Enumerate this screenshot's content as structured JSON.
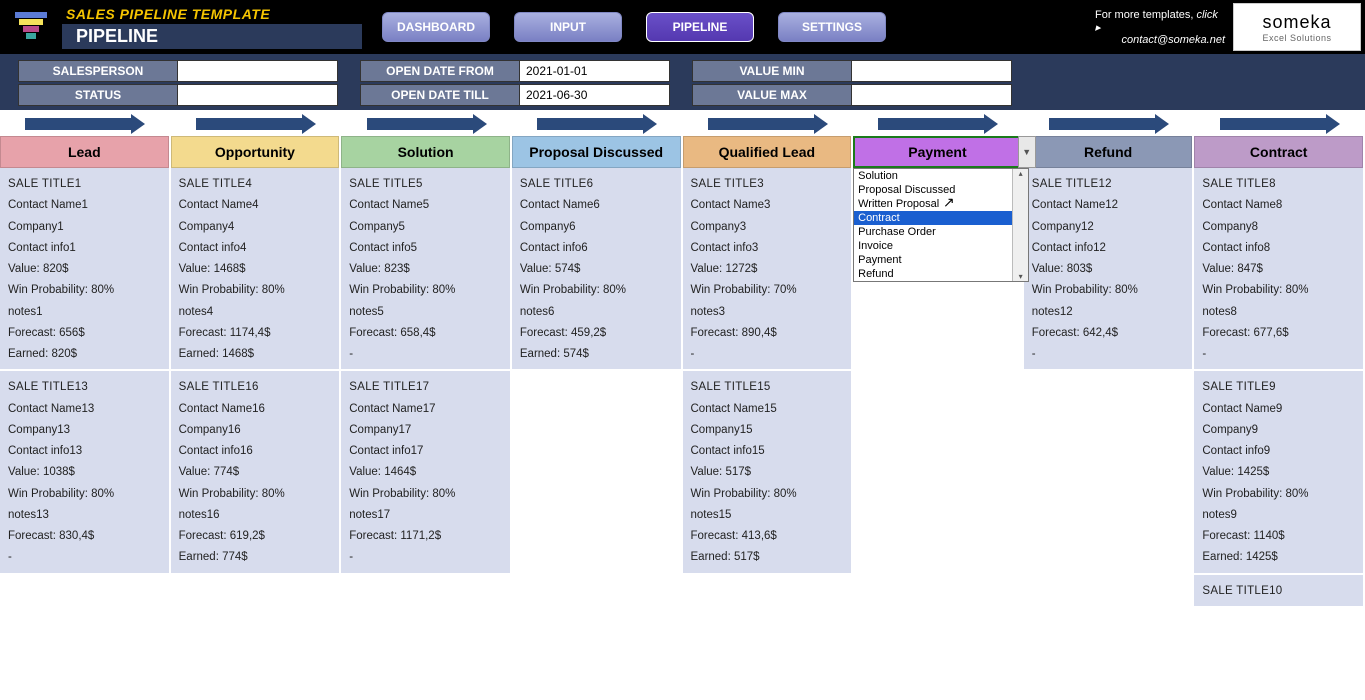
{
  "header": {
    "top_title": "SALES PIPELINE TEMPLATE",
    "page": "PIPELINE",
    "nav": [
      {
        "label": "DASHBOARD",
        "active": false
      },
      {
        "label": "INPUT",
        "active": false
      },
      {
        "label": "PIPELINE",
        "active": true
      },
      {
        "label": "SETTINGS",
        "active": false
      }
    ],
    "more_templates": "For more templates, ",
    "more_templates_link": "click ▸",
    "contact": "contact@someka.net",
    "brand_line1": "someka",
    "brand_line2": "Excel Solutions"
  },
  "filters": {
    "salesperson": {
      "label": "SALESPERSON",
      "value": ""
    },
    "status": {
      "label": "STATUS",
      "value": ""
    },
    "open_from": {
      "label": "OPEN DATE FROM",
      "value": "2021-01-01"
    },
    "open_till": {
      "label": "OPEN DATE TILL",
      "value": "2021-06-30"
    },
    "value_min": {
      "label": "VALUE MIN",
      "value": ""
    },
    "value_max": {
      "label": "VALUE MAX",
      "value": ""
    }
  },
  "stages": [
    {
      "label": "Lead",
      "color": "#e7a2aa"
    },
    {
      "label": "Opportunity",
      "color": "#f3da8e"
    },
    {
      "label": "Solution",
      "color": "#a7d3a1"
    },
    {
      "label": "Proposal Discussed",
      "color": "#9cc4e4"
    },
    {
      "label": "Qualified Lead",
      "color": "#e9b982"
    },
    {
      "label": "Payment",
      "color": "#c070e6"
    },
    {
      "label": "Refund",
      "color": "#8b98b5"
    },
    {
      "label": "Contract",
      "color": "#bd9bc8"
    }
  ],
  "dropdown": {
    "items": [
      "Solution",
      "Proposal Discussed",
      "Written Proposal",
      "Contract",
      "Purchase Order",
      "Invoice",
      "Payment",
      "Refund"
    ],
    "selected": "Contract"
  },
  "columns": [
    [
      {
        "title": "SALE TITLE1",
        "contact": "Contact Name1",
        "company": "Company1",
        "info": "Contact info1",
        "value": "Value: 820$",
        "prob": "Win Probability: 80%",
        "notes": "notes1",
        "forecast": "Forecast: 656$",
        "earned": "Earned: 820$"
      },
      {
        "title": "SALE TITLE13",
        "contact": "Contact Name13",
        "company": "Company13",
        "info": "Contact info13",
        "value": "Value: 1038$",
        "prob": "Win Probability: 80%",
        "notes": "notes13",
        "forecast": "Forecast: 830,4$",
        "earned": "-"
      }
    ],
    [
      {
        "title": "SALE TITLE4",
        "contact": "Contact Name4",
        "company": "Company4",
        "info": "Contact info4",
        "value": "Value: 1468$",
        "prob": "Win Probability: 80%",
        "notes": "notes4",
        "forecast": "Forecast: 1174,4$",
        "earned": "Earned: 1468$"
      },
      {
        "title": "SALE TITLE16",
        "contact": "Contact Name16",
        "company": "Company16",
        "info": "Contact info16",
        "value": "Value: 774$",
        "prob": "Win Probability: 80%",
        "notes": "notes16",
        "forecast": "Forecast: 619,2$",
        "earned": "Earned: 774$"
      }
    ],
    [
      {
        "title": "SALE TITLE5",
        "contact": "Contact Name5",
        "company": "Company5",
        "info": "Contact info5",
        "value": "Value: 823$",
        "prob": "Win Probability: 80%",
        "notes": "notes5",
        "forecast": "Forecast: 658,4$",
        "earned": "-"
      },
      {
        "title": "SALE TITLE17",
        "contact": "Contact Name17",
        "company": "Company17",
        "info": "Contact info17",
        "value": "Value: 1464$",
        "prob": "Win Probability: 80%",
        "notes": "notes17",
        "forecast": "Forecast: 1171,2$",
        "earned": "-"
      }
    ],
    [
      {
        "title": "SALE TITLE6",
        "contact": "Contact Name6",
        "company": "Company6",
        "info": "Contact info6",
        "value": "Value: 574$",
        "prob": "Win Probability: 80%",
        "notes": "notes6",
        "forecast": "Forecast: 459,2$",
        "earned": "Earned: 574$"
      }
    ],
    [
      {
        "title": "SALE TITLE3",
        "contact": "Contact Name3",
        "company": "Company3",
        "info": "Contact info3",
        "value": "Value: 1272$",
        "prob": "Win Probability: 70%",
        "notes": "notes3",
        "forecast": "Forecast: 890,4$",
        "earned": "-"
      },
      {
        "title": "SALE TITLE15",
        "contact": "Contact Name15",
        "company": "Company15",
        "info": "Contact info15",
        "value": "Value: 517$",
        "prob": "Win Probability: 80%",
        "notes": "notes15",
        "forecast": "Forecast: 413,6$",
        "earned": "Earned: 517$"
      }
    ],
    [],
    [
      {
        "title": "SALE TITLE12",
        "contact": "Contact Name12",
        "company": "Company12",
        "info": "Contact info12",
        "value": "Value: 803$",
        "prob": "Win Probability: 80%",
        "notes": "notes12",
        "forecast": "Forecast: 642,4$",
        "earned": "-"
      }
    ],
    [
      {
        "title": "SALE TITLE8",
        "contact": "Contact Name8",
        "company": "Company8",
        "info": "Contact info8",
        "value": "Value: 847$",
        "prob": "Win Probability: 80%",
        "notes": "notes8",
        "forecast": "Forecast: 677,6$",
        "earned": "-"
      },
      {
        "title": "SALE TITLE9",
        "contact": "Contact Name9",
        "company": "Company9",
        "info": "Contact info9",
        "value": "Value: 1425$",
        "prob": "Win Probability: 80%",
        "notes": "notes9",
        "forecast": "Forecast: 1140$",
        "earned": "Earned: 1425$"
      },
      {
        "title": "SALE TITLE10"
      }
    ]
  ]
}
